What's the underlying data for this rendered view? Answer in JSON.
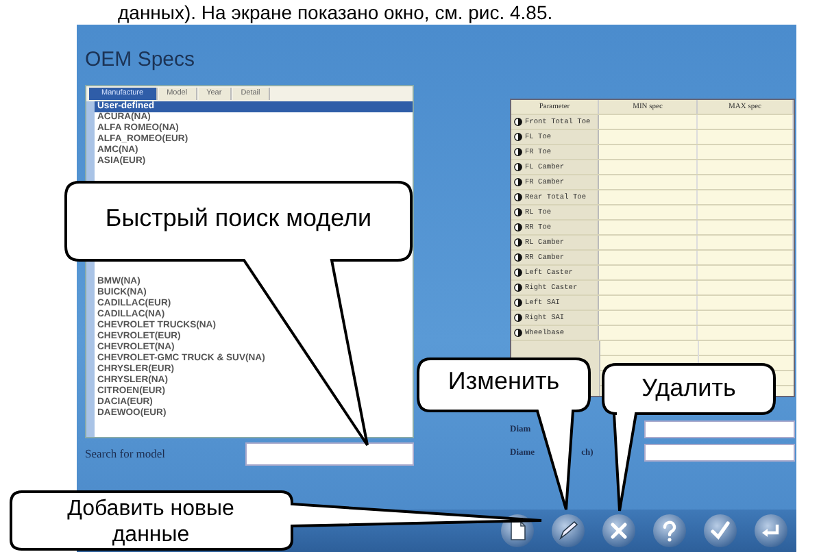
{
  "page_text": "данных). На экране показано окно, см. рис. 4.85.",
  "window": {
    "title": "OEM Specs"
  },
  "tabs": [
    {
      "label": "Manufacture",
      "selected": true
    },
    {
      "label": "Model",
      "selected": false
    },
    {
      "label": "Year",
      "selected": false
    },
    {
      "label": "Detail",
      "selected": false
    }
  ],
  "manufacturers": [
    {
      "name": "User-defined",
      "selected": true
    },
    {
      "name": "ACURA(NA)",
      "selected": false
    },
    {
      "name": "ALFA ROMEO(NA)",
      "selected": false
    },
    {
      "name": "ALFA_ROMEO(EUR)",
      "selected": false
    },
    {
      "name": "AMC(NA)",
      "selected": false
    },
    {
      "name": "ASIA(EUR)",
      "selected": false
    },
    {
      "name": "BMW(NA)",
      "selected": false
    },
    {
      "name": "BUICK(NA)",
      "selected": false
    },
    {
      "name": "CADILLAC(EUR)",
      "selected": false
    },
    {
      "name": "CADILLAC(NA)",
      "selected": false
    },
    {
      "name": "CHEVROLET TRUCKS(NA)",
      "selected": false
    },
    {
      "name": "CHEVROLET(EUR)",
      "selected": false
    },
    {
      "name": "CHEVROLET(NA)",
      "selected": false
    },
    {
      "name": "CHEVROLET-GMC TRUCK & SUV(NA)",
      "selected": false
    },
    {
      "name": "CHRYSLER(EUR)",
      "selected": false
    },
    {
      "name": "CHRYSLER(NA)",
      "selected": false
    },
    {
      "name": "CITROEN(EUR)",
      "selected": false
    },
    {
      "name": "DACIA(EUR)",
      "selected": false
    },
    {
      "name": "DAEWOO(EUR)",
      "selected": false
    }
  ],
  "spec_table": {
    "columns": [
      "Parameter",
      "MIN spec",
      "MAX spec"
    ],
    "rows": [
      {
        "parameter": "Front Total Toe"
      },
      {
        "parameter": "FL Toe"
      },
      {
        "parameter": "FR Toe"
      },
      {
        "parameter": "FL Camber"
      },
      {
        "parameter": "FR Camber"
      },
      {
        "parameter": "Rear Total Toe"
      },
      {
        "parameter": "RL Toe"
      },
      {
        "parameter": "RR Toe"
      },
      {
        "parameter": "RL Camber"
      },
      {
        "parameter": "RR Camber"
      },
      {
        "parameter": "Left Caster"
      },
      {
        "parameter": "Right Caster"
      },
      {
        "parameter": "Left SAI"
      },
      {
        "parameter": "Right SAI"
      },
      {
        "parameter": "Wheelbase"
      }
    ]
  },
  "search": {
    "label": "Search for model"
  },
  "diameter_rows": [
    {
      "label_parts": [
        "Diam"
      ]
    },
    {
      "label_parts": [
        "Diame",
        "ch)"
      ]
    }
  ],
  "toolbar": [
    {
      "kind": "add"
    },
    {
      "kind": "edit"
    },
    {
      "kind": "delete"
    },
    {
      "kind": "help"
    },
    {
      "kind": "confirm"
    },
    {
      "kind": "exit"
    }
  ],
  "callouts": [
    {
      "text": "Быстрый поиск модели"
    },
    {
      "text": "Изменить"
    },
    {
      "text": "Удалить"
    },
    {
      "text": "Добавить новые данные"
    }
  ]
}
